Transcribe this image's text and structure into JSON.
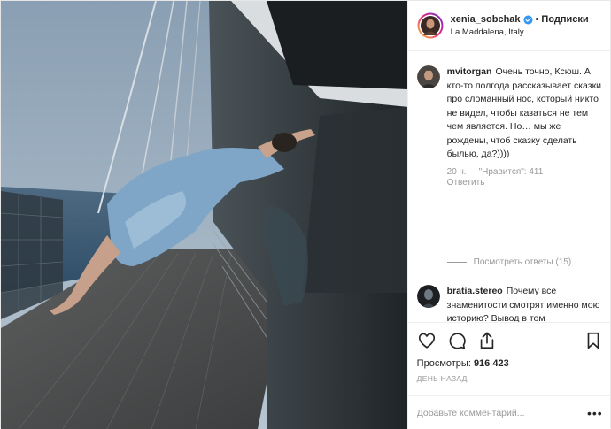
{
  "header": {
    "username": "xenia_sobchak",
    "separator": "•",
    "follow_label": "Подписки",
    "location": "La Maddalena, Italy"
  },
  "comments": [
    {
      "user": "mvitorgan",
      "text": "Очень точно, Ксюш. А кто-то полгода рассказывает сказки про сломанный нос, который никто не видел, чтобы казаться не тем чем является. Но… мы же рождены, чтоб сказку сделать былью, да?))))",
      "time": "20 ч.",
      "likes": "\"Нравится\": 411",
      "reply_label": "Ответить",
      "view_replies": "Посмотреть ответы (15)"
    },
    {
      "user": "bratia.stereo",
      "text": "Почему все знаменитости смотрят именно мою историю? Вывод в том"
    }
  ],
  "actions": {
    "icons": [
      "heart-icon",
      "comment-icon",
      "share-icon",
      "bookmark-icon"
    ],
    "views_label": "Просмотры:",
    "views_count": "916 423",
    "time_ago": "ДЕНЬ НАЗАД"
  },
  "add_comment": {
    "placeholder": "Добавьте комментарий...",
    "more": "•••"
  },
  "colors": {
    "text": "#262626",
    "muted": "#999999",
    "border": "#efefef",
    "verified": "#3897f0"
  }
}
